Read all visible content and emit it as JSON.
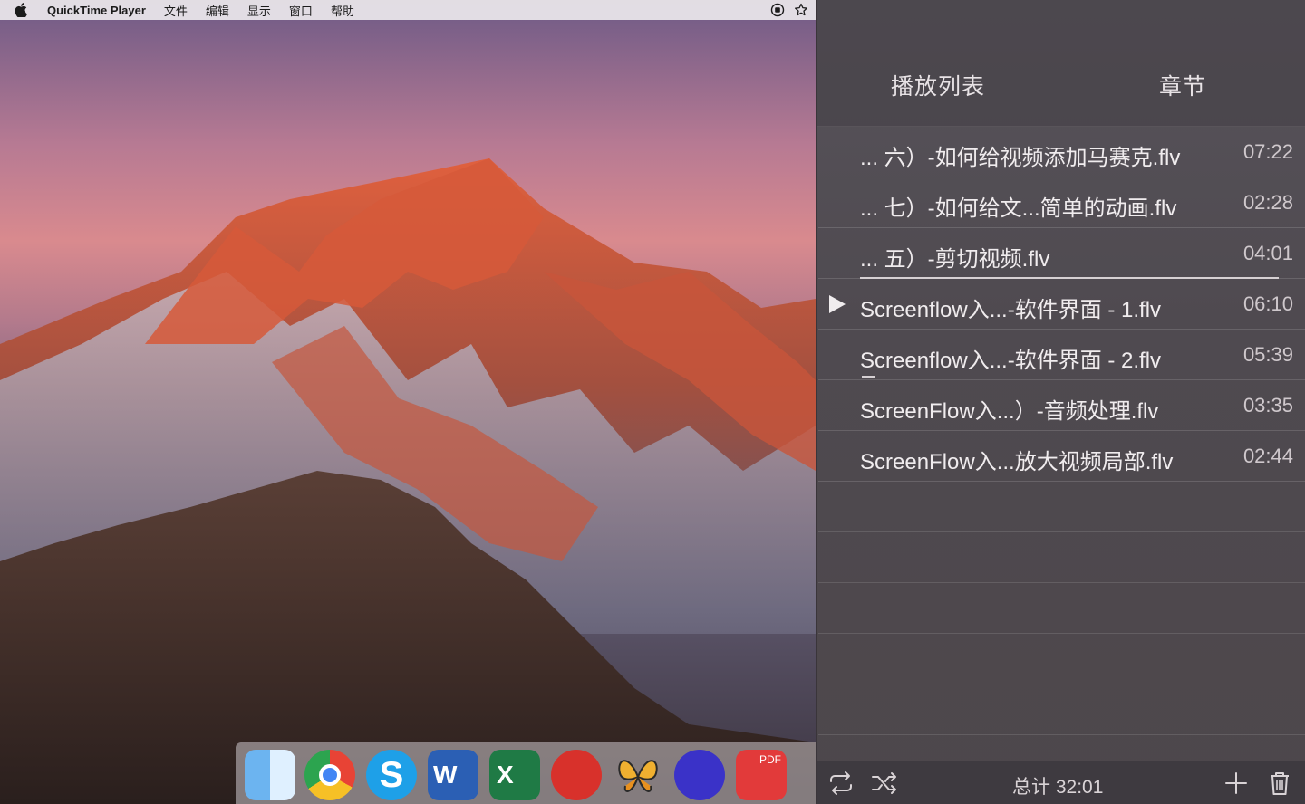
{
  "menubar": {
    "app_name": "QuickTime Player",
    "items": [
      "文件",
      "编辑",
      "显示",
      "窗口",
      "帮助"
    ],
    "icons": [
      "apple-icon",
      "record-icon",
      "star-icon"
    ]
  },
  "playlist": {
    "tabs": {
      "playlist": "播放列表",
      "chapters": "章节"
    },
    "items": [
      {
        "name": "... 六）-如何给视频添加马赛克.flv",
        "duration": "07:22"
      },
      {
        "name": "... 七）-如何给文...简单的动画.flv",
        "duration": "02:28"
      },
      {
        "name": "... 五）-剪切视频.flv",
        "duration": "04:01"
      },
      {
        "name": "Screenflow入...-软件界面 - 1.flv",
        "duration": "06:10",
        "playing": true
      },
      {
        "name": "Screenflow入...-软件界面 - 2.flv",
        "duration": "05:39"
      },
      {
        "name": "ScreenFlow入...）-音频处理.flv",
        "duration": "03:35"
      },
      {
        "name": "ScreenFlow入...放大视频局部.flv",
        "duration": "02:44"
      }
    ],
    "footer": {
      "total": "总计 32:01",
      "icons": [
        "repeat-icon",
        "shuffle-icon",
        "add-icon",
        "trash-icon"
      ]
    }
  },
  "dock": {
    "apps": [
      "finder-icon",
      "chrome-icon",
      "skype-icon",
      "word-icon",
      "excel-icon",
      "bear-icon",
      "tes-icon",
      "screenflow-icon",
      "pdf-icon"
    ]
  }
}
